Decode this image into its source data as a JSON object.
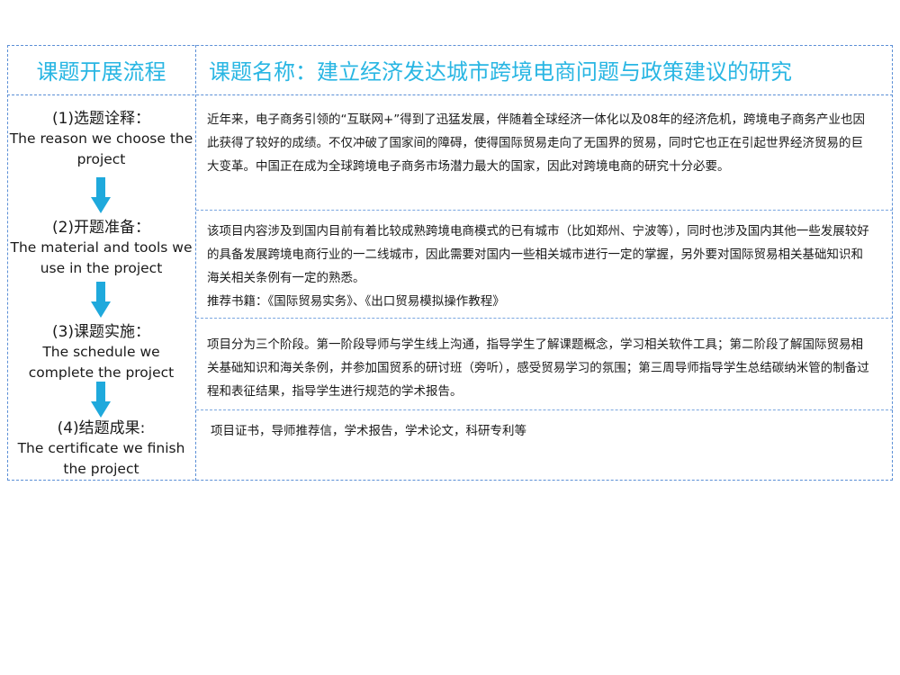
{
  "header": {
    "left_title": "课题开展流程",
    "right_title": "课题名称：建立经济发达城市跨境电商问题与政策建议的研究"
  },
  "steps": [
    {
      "cn": "(1)选题诠释：",
      "en": "The reason we choose the project"
    },
    {
      "cn": "(2)开题准备：",
      "en": "The material and tools we use in the project"
    },
    {
      "cn": "(3)课题实施：",
      "en": "The schedule we complete the project"
    },
    {
      "cn": "(4)结题成果:",
      "en": "The certificate we finish the project"
    }
  ],
  "details": [
    {
      "text": "近年来，电子商务引领的“互联网+”得到了迅猛发展，伴随着全球经济一体化以及08年的经济危机，跨境电子商务产业也因此获得了较好的成绩。不仅冲破了国家间的障碍，使得国际贸易走向了无国界的贸易，同时它也正在引起世界经济贸易的巨大变革。中国正在成为全球跨境电子商务市场潜力最大的国家，因此对跨境电商的研究十分必要。"
    },
    {
      "text": "该项目内容涉及到国内目前有着比较成熟跨境电商模式的已有城市（比如郑州、宁波等），同时也涉及国内其他一些发展较好的具备发展跨境电商行业的一二线城市，因此需要对国内一些相关城市进行一定的掌握，另外要对国际贸易相关基础知识和海关相关条例有一定的熟悉。",
      "books": "推荐书籍：《国际贸易实务》、《出口贸易模拟操作教程》"
    },
    {
      "text": "项目分为三个阶段。第一阶段导师与学生线上沟通，指导学生了解课题概念，学习相关软件工具；第二阶段了解国际贸易相关基础知识和海关条例，并参加国贸系的研讨班（旁听），感受贸易学习的氛围；第三周导师指导学生总结碳纳米管的制备过程和表征结果，指导学生进行规范的学术报告。"
    },
    {
      "text": "项目证书，导师推荐信，学术报告，学术论文，科研专利等"
    }
  ],
  "colors": {
    "accent": "#29b6e3",
    "border": "#5b8fd6",
    "arrow": "#1fa9dc"
  },
  "icons": {
    "arrow": "down-arrow-icon"
  }
}
